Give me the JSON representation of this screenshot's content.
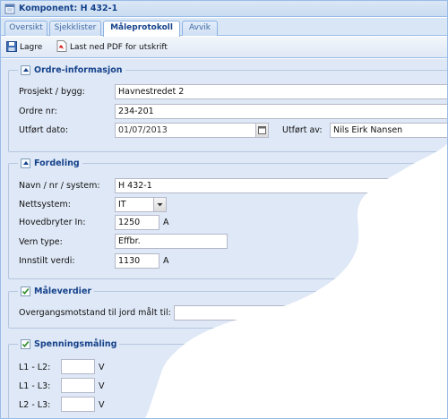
{
  "window": {
    "title": "Komponent: H 432-1"
  },
  "tabs": [
    {
      "label": "Oversikt"
    },
    {
      "label": "Sjekklister"
    },
    {
      "label": "Måleprotokoll"
    },
    {
      "label": "Avvik"
    }
  ],
  "toolbar": {
    "save_label": "Lagre",
    "pdf_label": "Last ned PDF for utskrift"
  },
  "ordre": {
    "legend": "Ordre-informasjon",
    "prosjekt_label": "Prosjekt / bygg:",
    "prosjekt_value": "Havnestredet 2",
    "ordre_label": "Ordre nr:",
    "ordre_value": "234-201",
    "dato_label": "Utført dato:",
    "dato_value": "01/07/2013",
    "utfort_av_label": "Utført av:",
    "utfort_av_value": "Nils Eirk  Nansen"
  },
  "fordeling": {
    "legend": "Fordeling",
    "navn_label": "Navn / nr / system:",
    "navn_value": "H 432-1",
    "nettsystem_label": "Nettsystem:",
    "nettsystem_value": "IT",
    "hovedbryter_label": "Hovedbryter In:",
    "hovedbryter_value": "1250",
    "hovedbryter_unit": "A",
    "vern_label": "Vern type:",
    "vern_value": "Effbr.",
    "innstilt_label": "Innstilt verdi:",
    "innstilt_value": "1130",
    "innstilt_unit": "A"
  },
  "maleverdier": {
    "legend": "Måleverdier",
    "checked": true,
    "overgang_label": "Overgangsmotstand til jord målt til:",
    "overgang_value": ""
  },
  "spenning": {
    "legend": "Spenningsmåling",
    "checked": true,
    "rows": [
      {
        "label": "L1 - L2:",
        "value": "",
        "unit": "V"
      },
      {
        "label": "L1 - L3:",
        "value": "",
        "unit": "V"
      },
      {
        "label": "L2 - L3:",
        "value": "",
        "unit": "V"
      }
    ]
  },
  "colors": {
    "header_text": "#15428b",
    "panel_bg": "#dfe8f6",
    "border": "#99bbe8"
  }
}
